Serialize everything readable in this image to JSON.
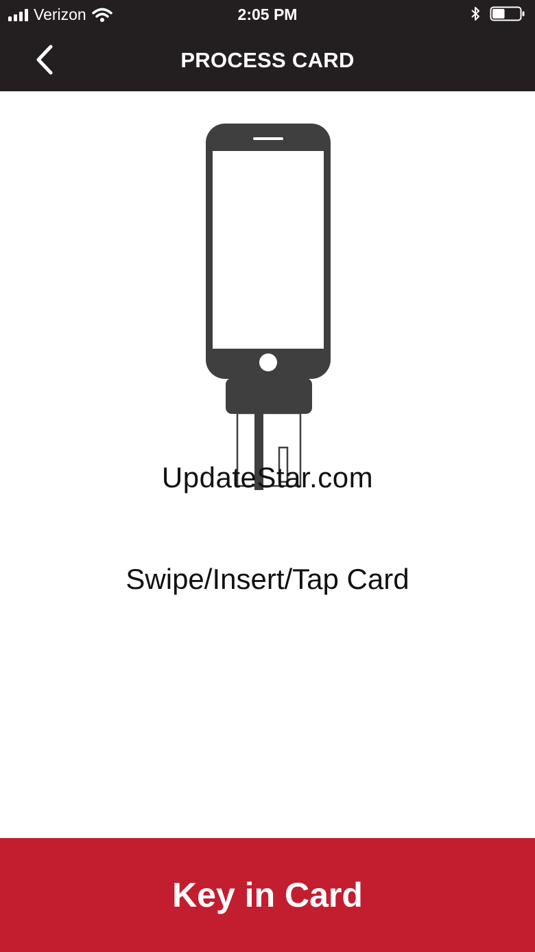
{
  "status_bar": {
    "carrier": "Verizon",
    "time": "2:05 PM",
    "battery_level": 0.45
  },
  "nav": {
    "title": "PROCESS CARD",
    "back_icon": "chevron-left-icon"
  },
  "main": {
    "illustration_icon": "phone-with-card-reader-icon",
    "watermark": "UpdateStar.com",
    "prompt": "Swipe/Insert/Tap Card"
  },
  "footer": {
    "button_label": "Key in Card"
  },
  "colors": {
    "header_bg": "#231f20",
    "accent": "#c21e2f",
    "icon": "#3f3f3f"
  }
}
